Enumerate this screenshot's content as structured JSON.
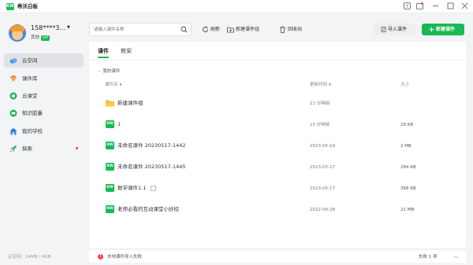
{
  "app": {
    "logo_text": "KW",
    "title": "希沃白板"
  },
  "user": {
    "name": "158****3...",
    "subtitle": "其他",
    "badge": "VIP"
  },
  "sidebar": {
    "items": [
      {
        "label": "云空间",
        "icon": "cloud-icon",
        "active": true
      },
      {
        "label": "课件库",
        "icon": "gem-icon",
        "active": false
      },
      {
        "label": "云课堂",
        "icon": "classroom-icon",
        "active": false
      },
      {
        "label": "知识胶囊",
        "icon": "capsule-icon",
        "active": false
      },
      {
        "label": "我的学校",
        "icon": "school-icon",
        "active": false
      },
      {
        "label": "探索",
        "icon": "rocket-icon",
        "active": false
      }
    ],
    "storage": "云空间：24MB / 4GB"
  },
  "toolbar": {
    "search_placeholder": "请输入课件名称",
    "refresh_label": "刷新",
    "new_group_label": "新建课件组",
    "recycle_label": "回收站",
    "import_label": "导入课件",
    "new_label": "新建课件"
  },
  "tabs": [
    {
      "label": "课件",
      "active": true
    },
    {
      "label": "教案",
      "active": false
    }
  ],
  "breadcrumb": "我的课件",
  "table": {
    "headers": {
      "name": "课件名",
      "updated": "更新时间",
      "size": "大小"
    },
    "rows": [
      {
        "name": "新建课件组",
        "updated": "21 分钟前",
        "size": "",
        "type": "folder"
      },
      {
        "name": "1",
        "updated": "15 分钟前",
        "size": "29 KB",
        "type": "courseware"
      },
      {
        "name": "未命名课件 20230517-1442",
        "updated": "2023-05-19",
        "size": "2 MB",
        "type": "courseware"
      },
      {
        "name": "未命名课件 20230517-1445",
        "updated": "2023-05-17",
        "size": "284 KB",
        "type": "courseware"
      },
      {
        "name": "数学课件1.1",
        "updated": "2023-05-17",
        "size": "368 KB",
        "type": "courseware-linked"
      },
      {
        "name": "老师必看的互动课堂小妙招",
        "updated": "2022-06-28",
        "size": "21 MB",
        "type": "courseware"
      }
    ]
  },
  "status": {
    "message": "本地课件导入失败",
    "fail_count": "失败 1 项"
  },
  "colors": {
    "accent": "#19b955",
    "error": "#f04848"
  }
}
